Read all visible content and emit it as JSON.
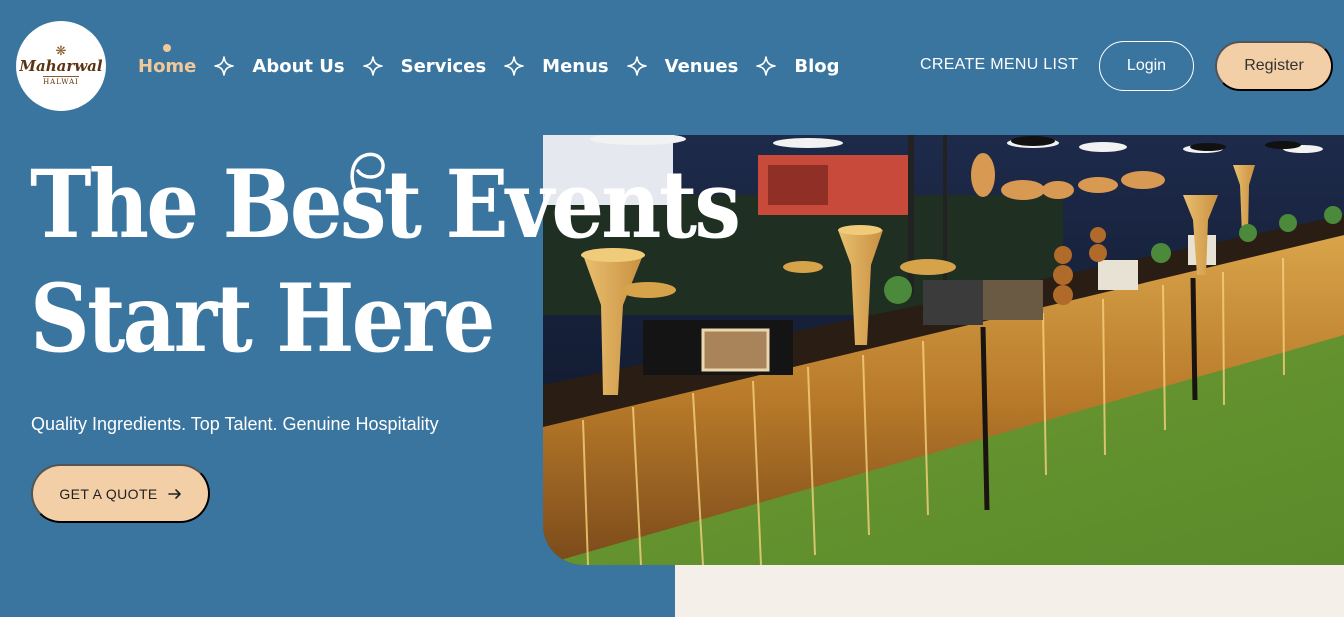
{
  "logo": {
    "brand": "Maharwal",
    "sub": "HALWAI",
    "ornament": "❋"
  },
  "nav": [
    {
      "label": "Home",
      "active": true
    },
    {
      "label": "About Us"
    },
    {
      "label": "Services"
    },
    {
      "label": "Menus"
    },
    {
      "label": "Venues"
    },
    {
      "label": "Blog"
    }
  ],
  "header": {
    "create_menu_label": "CREATE MENU LIST",
    "login_label": "Login",
    "register_label": "Register"
  },
  "hero": {
    "headline_line1": "The Best Events",
    "headline_line2": "Start Here",
    "tagline": "Quality Ingredients. Top Talent. Genuine Hospitality",
    "cta_label": "GET A QUOTE",
    "image_description_icon": "buffet-photo"
  },
  "colors": {
    "background": "#3a75a0",
    "accent": "#f2cfa7",
    "active_nav": "#f0c99a",
    "cream": "#f5efe9"
  },
  "icons": {
    "separator": "four-point-star-icon",
    "cta_arrow": "arrow-right-icon"
  }
}
